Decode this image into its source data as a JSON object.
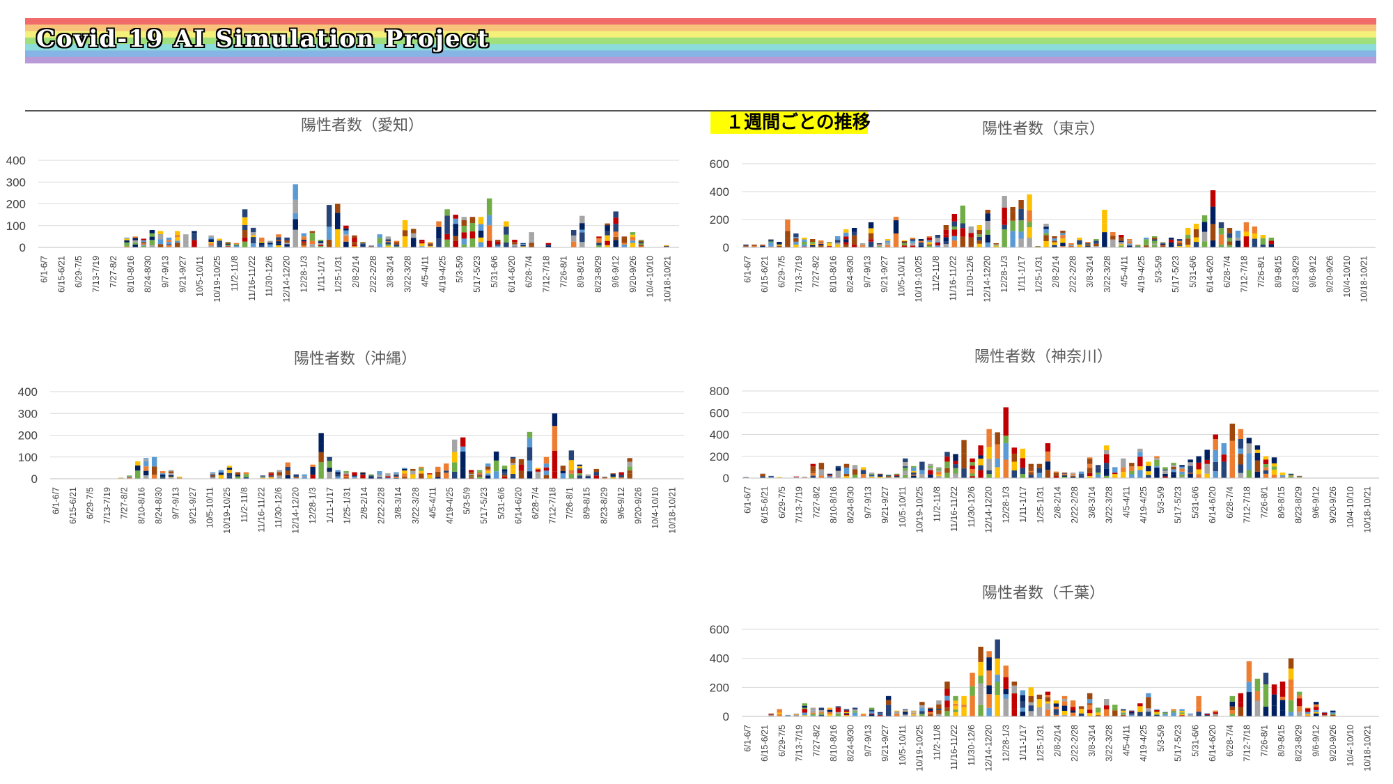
{
  "header": {
    "title": "Covid-19 AI Simulation Project",
    "section_label": "１週間ごとの推移",
    "rainbow_colors": [
      "#f26b6b",
      "#f8c37a",
      "#f5f07a",
      "#9fe07c",
      "#8cdcdc",
      "#86b4e4",
      "#b89ad8"
    ]
  },
  "chart_data": [
    {
      "id": "aichi",
      "type": "bar",
      "stacked": true,
      "title": "陽性者数（愛知）",
      "ylim": [
        0,
        400
      ],
      "yticks": [
        0,
        100,
        200,
        300,
        400
      ],
      "grid": true,
      "categories": [
        "6/1-6/7",
        "6/15-6/21",
        "6/29-7/5",
        "7/13-7/19",
        "7/27-8/2",
        "8/10-8/16",
        "8/24-8/30",
        "9/7-9/13",
        "9/21-9/27",
        "10/5-10/11",
        "10/19-10/25",
        "11/2-11/8",
        "11/16-11/22",
        "11/30-12/6",
        "12/14-12/20",
        "12/28-1/3",
        "1/11-1/17",
        "1/25-1/31",
        "2/8-2/14",
        "2/22-2/28",
        "3/8-3/14",
        "3/22-3/28",
        "4/5-4/11",
        "4/19-4/25",
        "5/3-5/9",
        "5/17-5/23",
        "5/31-6/6",
        "6/14-6/20",
        "6/28-7/4",
        "7/12-7/18",
        "7/26-8/1",
        "8/9-8/15",
        "8/23-8/29",
        "9/6-9/12",
        "9/20-9/26",
        "10/4-10/10",
        "10/18-10/21"
      ],
      "totals": [
        0,
        0,
        0,
        0,
        0,
        0,
        0,
        0,
        0,
        0,
        45,
        50,
        40,
        80,
        75,
        45,
        75,
        60,
        75,
        0,
        55,
        40,
        25,
        20,
        175,
        90,
        45,
        30,
        60,
        45,
        290,
        65,
        75,
        35,
        195,
        200,
        100,
        55,
        25,
        10,
        60,
        50,
        30,
        125,
        85,
        35,
        25,
        120,
        175,
        150,
        140,
        140,
        140,
        225,
        35,
        120,
        35,
        20,
        70,
        0,
        20,
        0,
        0,
        80,
        145,
        0,
        50,
        110,
        165,
        50,
        70,
        35,
        0,
        0,
        10,
        0
      ],
      "values": [
        0,
        0,
        0,
        0,
        0,
        0,
        0,
        0,
        0,
        0,
        45,
        50,
        40,
        80,
        75,
        45,
        75,
        60,
        75,
        0,
        55,
        40,
        25,
        20,
        175,
        90,
        45,
        30,
        60,
        45,
        290,
        65,
        75,
        35,
        195,
        200,
        100,
        55,
        25,
        10,
        60,
        50,
        30,
        125,
        85,
        35,
        25,
        120,
        175,
        150,
        140,
        140,
        140,
        225,
        35,
        120,
        35,
        20,
        70,
        0,
        20,
        0,
        0,
        80,
        145,
        0,
        50,
        110,
        165,
        50,
        70,
        35,
        0,
        0,
        10,
        0
      ]
    },
    {
      "id": "tokyo",
      "type": "bar",
      "stacked": true,
      "title": "陽性者数（東京）",
      "ylim": [
        0,
        600
      ],
      "yticks": [
        0,
        200,
        400,
        600
      ],
      "grid": true,
      "categories": [
        "6/1-6/7",
        "6/15-6/21",
        "6/29-7/5",
        "7/13-7/19",
        "7/27-8/2",
        "8/10-8/16",
        "8/24-8/30",
        "9/7-9/13",
        "9/21-9/27",
        "10/5-10/11",
        "10/19-10/25",
        "11/2-11/8",
        "11/16-11/22",
        "11/30-12/6",
        "12/14-12/20",
        "12/28-1/3",
        "1/11-1/17",
        "1/25-1/31",
        "2/8-2/14",
        "2/22-2/28",
        "3/8-3/14",
        "3/22-3/28",
        "4/5-4/11",
        "4/19-4/25",
        "5/3-5/9",
        "5/17-5/23",
        "5/31-6/6",
        "6/14-6/20",
        "6/28-7/4",
        "7/12-7/18",
        "7/26-8/1",
        "8/9-8/15",
        "8/23-8/29",
        "9/6-9/12",
        "9/20-9/26",
        "10/4-10/10",
        "10/18-10/21"
      ],
      "values": [
        20,
        20,
        20,
        60,
        40,
        200,
        100,
        70,
        60,
        50,
        40,
        80,
        130,
        140,
        30,
        180,
        30,
        60,
        220,
        50,
        70,
        60,
        80,
        90,
        160,
        240,
        300,
        150,
        160,
        270,
        30,
        370,
        290,
        340,
        380,
        10,
        170,
        80,
        120,
        30,
        70,
        40,
        60,
        270,
        110,
        90,
        60,
        20,
        70,
        80,
        40,
        70,
        60,
        140,
        170,
        230,
        410,
        180,
        140,
        120,
        180,
        150,
        90,
        70,
        0,
        0,
        0,
        0,
        0,
        0,
        0,
        0,
        0,
        0,
        0,
        0
      ]
    },
    {
      "id": "okinawa",
      "type": "bar",
      "stacked": true,
      "title": "陽性者数（沖縄）",
      "ylim": [
        0,
        400
      ],
      "yticks": [
        0,
        100,
        200,
        300,
        400
      ],
      "grid": true,
      "categories": [
        "6/1-6/7",
        "6/15-6/21",
        "6/29-7/5",
        "7/13-7/19",
        "7/27-8/2",
        "8/10-8/16",
        "8/24-8/30",
        "9/7-9/13",
        "9/21-9/27",
        "10/5-10/11",
        "10/19-10/25",
        "11/2-11/8",
        "11/16-11/22",
        "11/30-12/6",
        "12/14-12/20",
        "12/28-1/3",
        "1/11-1/17",
        "1/25-1/31",
        "2/8-2/14",
        "2/22-2/28",
        "3/8-3/14",
        "3/22-3/28",
        "4/5-4/11",
        "4/19-4/25",
        "5/3-5/9",
        "5/17-5/23",
        "5/31-6/6",
        "6/14-6/20",
        "6/28-7/4",
        "7/12-7/18",
        "7/26-8/1",
        "8/9-8/15",
        "8/23-8/29",
        "9/6-9/12",
        "9/20-9/26",
        "10/4-10/10",
        "10/18-10/21"
      ],
      "values": [
        0,
        0,
        0,
        0,
        0,
        0,
        0,
        0,
        5,
        15,
        80,
        95,
        100,
        35,
        40,
        10,
        0,
        0,
        0,
        30,
        40,
        60,
        30,
        30,
        0,
        15,
        30,
        40,
        75,
        20,
        20,
        65,
        210,
        100,
        40,
        35,
        30,
        30,
        20,
        35,
        25,
        30,
        50,
        45,
        55,
        25,
        55,
        70,
        180,
        190,
        40,
        40,
        70,
        125,
        60,
        100,
        90,
        215,
        50,
        100,
        300,
        60,
        130,
        65,
        20,
        45,
        10,
        25,
        30,
        95,
        0,
        0,
        0,
        0,
        0,
        0
      ]
    },
    {
      "id": "kanagawa",
      "type": "bar",
      "stacked": true,
      "title": "陽性者数（神奈川）",
      "ylim": [
        0,
        800
      ],
      "yticks": [
        0,
        200,
        400,
        600,
        800
      ],
      "grid": true,
      "categories": [
        "6/1-6/7",
        "6/15-6/21",
        "6/29-7/5",
        "7/13-7/19",
        "7/27-8/2",
        "8/10-8/16",
        "8/24-8/30",
        "9/7-9/13",
        "9/21-9/27",
        "10/5-10/11",
        "10/19-10/25",
        "11/2-11/8",
        "11/16-11/22",
        "11/30-12/6",
        "12/14-12/20",
        "12/28-1/3",
        "1/11-1/17",
        "1/25-1/31",
        "2/8-2/14",
        "2/22-2/28",
        "3/8-3/14",
        "3/22-3/28",
        "4/5-4/11",
        "4/19-4/25",
        "5/3-5/9",
        "5/17-5/23",
        "5/31-6/6",
        "6/14-6/20",
        "6/28-7/4",
        "7/12-7/18",
        "7/26-8/1",
        "8/9-8/15",
        "8/23-8/29",
        "9/6-9/12",
        "9/20-9/26",
        "10/4-10/10",
        "10/18-10/21"
      ],
      "values": [
        10,
        0,
        40,
        20,
        10,
        0,
        15,
        10,
        130,
        140,
        40,
        110,
        130,
        120,
        100,
        50,
        40,
        30,
        40,
        180,
        110,
        150,
        130,
        100,
        240,
        220,
        350,
        180,
        300,
        450,
        420,
        650,
        280,
        270,
        130,
        130,
        320,
        60,
        50,
        50,
        60,
        190,
        120,
        300,
        100,
        180,
        140,
        270,
        150,
        200,
        100,
        140,
        120,
        170,
        200,
        260,
        400,
        320,
        500,
        450,
        370,
        300,
        200,
        190,
        50,
        40,
        20,
        0,
        0,
        0,
        0,
        0,
        0,
        0,
        0,
        0
      ]
    },
    {
      "id": "chiba",
      "type": "bar",
      "stacked": true,
      "title": "陽性者数（千葉）",
      "ylim": [
        0,
        600
      ],
      "yticks": [
        0,
        200,
        400,
        600
      ],
      "grid": true,
      "categories": [
        "6/1-6/7",
        "6/15-6/21",
        "6/29-7/5",
        "7/13-7/19",
        "7/27-8/2",
        "8/10-8/16",
        "8/24-8/30",
        "9/7-9/13",
        "9/21-9/27",
        "10/5-10/11",
        "10/19-10/25",
        "11/2-11/8",
        "11/16-11/22",
        "11/30-12/6",
        "12/14-12/20",
        "12/28-1/3",
        "1/11-1/17",
        "1/25-1/31",
        "2/8-2/14",
        "2/22-2/28",
        "3/8-3/14",
        "3/22-3/28",
        "4/5-4/11",
        "4/19-4/25",
        "5/3-5/9",
        "5/17-5/23",
        "5/31-6/6",
        "6/14-6/20",
        "6/28-7/4",
        "7/12-7/18",
        "7/26-8/1",
        "8/9-8/15",
        "8/23-8/29",
        "9/6-9/12",
        "9/20-9/26",
        "10/4-10/10",
        "10/18-10/21"
      ],
      "values": [
        0,
        0,
        0,
        20,
        50,
        10,
        20,
        90,
        60,
        60,
        60,
        70,
        50,
        60,
        20,
        60,
        30,
        140,
        40,
        50,
        40,
        100,
        60,
        110,
        240,
        140,
        140,
        300,
        480,
        450,
        530,
        350,
        240,
        180,
        200,
        150,
        170,
        110,
        140,
        110,
        70,
        160,
        60,
        120,
        80,
        50,
        40,
        90,
        160,
        50,
        30,
        50,
        50,
        20,
        140,
        20,
        40,
        0,
        140,
        160,
        380,
        260,
        300,
        220,
        240,
        400,
        170,
        60,
        100,
        30,
        40,
        0,
        0,
        0,
        0,
        0
      ]
    }
  ]
}
